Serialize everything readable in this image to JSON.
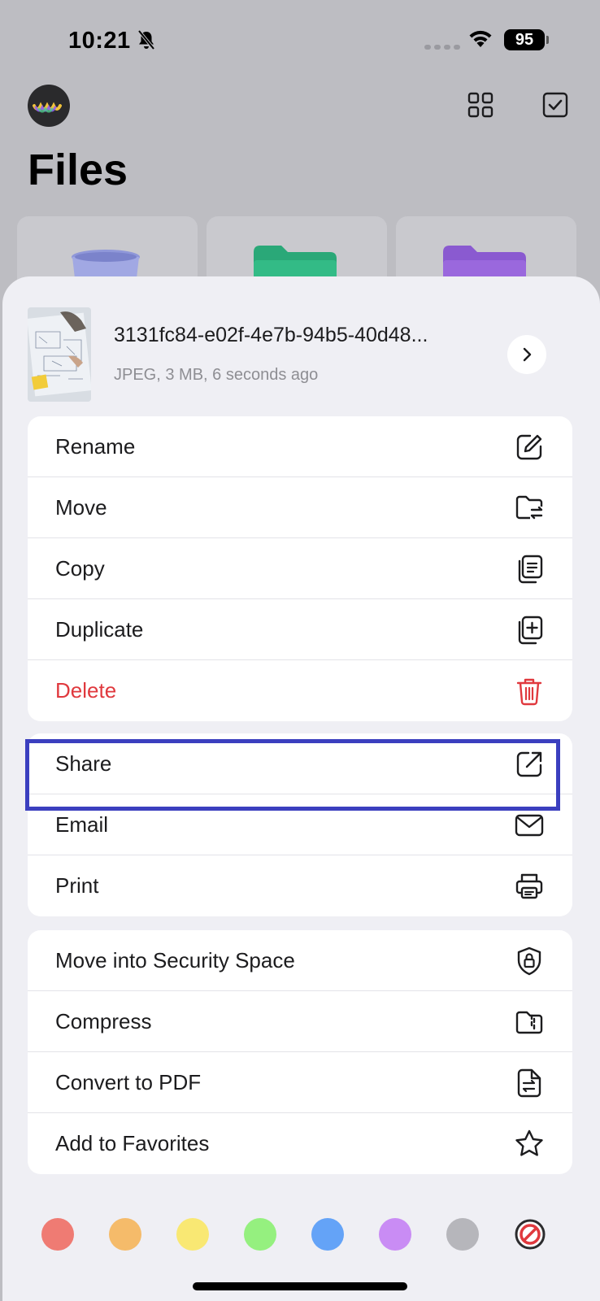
{
  "status_bar": {
    "time": "10:21",
    "battery": "95"
  },
  "header": {
    "title": "Files"
  },
  "file": {
    "name": "3131fc84-e02f-4e7b-94b5-40d48...",
    "meta": "JPEG, 3 MB, 6 seconds ago"
  },
  "menu_groups": [
    [
      {
        "label": "Rename",
        "icon": "edit-icon"
      },
      {
        "label": "Move",
        "icon": "folder-move-icon"
      },
      {
        "label": "Copy",
        "icon": "copy-icon"
      },
      {
        "label": "Duplicate",
        "icon": "duplicate-icon"
      },
      {
        "label": "Delete",
        "icon": "trash-icon"
      }
    ],
    [
      {
        "label": "Share",
        "icon": "share-icon"
      },
      {
        "label": "Email",
        "icon": "mail-icon"
      },
      {
        "label": "Print",
        "icon": "printer-icon"
      }
    ],
    [
      {
        "label": "Move into Security Space",
        "icon": "shield-lock-icon"
      },
      {
        "label": "Compress",
        "icon": "zip-icon"
      },
      {
        "label": "Convert to PDF",
        "icon": "convert-pdf-icon"
      },
      {
        "label": "Add to Favorites",
        "icon": "star-icon"
      }
    ]
  ],
  "tag_colors": [
    "#ef7b73",
    "#f5bb6a",
    "#f9e873",
    "#95f07f",
    "#64a3f7",
    "#c98cf4",
    "#b6b6bb",
    "none"
  ],
  "accent": {
    "danger": "#e0393e",
    "highlight": "#3b3fbf"
  }
}
